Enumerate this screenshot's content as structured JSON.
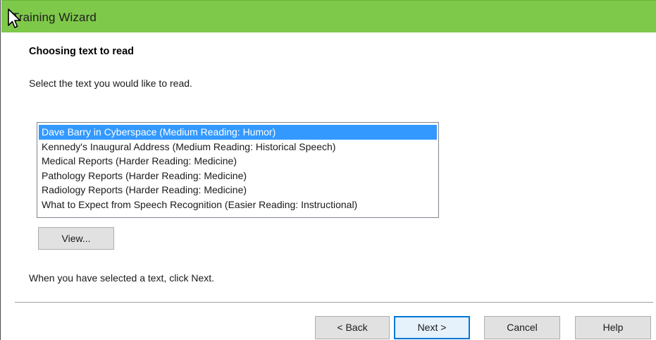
{
  "window": {
    "title": "Training Wizard",
    "accent_color": "#7ec84a"
  },
  "page": {
    "heading": "Choosing text to read",
    "instruction": "Select the text you would like to read.",
    "final_note": "When you have selected a text, click Next."
  },
  "texts_list": {
    "selected_index": 0,
    "items": [
      "Dave Barry in Cyberspace (Medium Reading: Humor)",
      "Kennedy's Inaugural Address (Medium Reading: Historical Speech)",
      "Medical Reports (Harder Reading: Medicine)",
      "Pathology Reports (Harder Reading: Medicine)",
      "Radiology Reports (Harder Reading: Medicine)",
      "What to Expect from Speech Recognition (Easier Reading: Instructional)"
    ]
  },
  "buttons": {
    "view": "View...",
    "back": "< Back",
    "next": "Next >",
    "cancel": "Cancel",
    "help": "Help"
  },
  "icons": {
    "cursor": "mouse-pointer-icon"
  }
}
